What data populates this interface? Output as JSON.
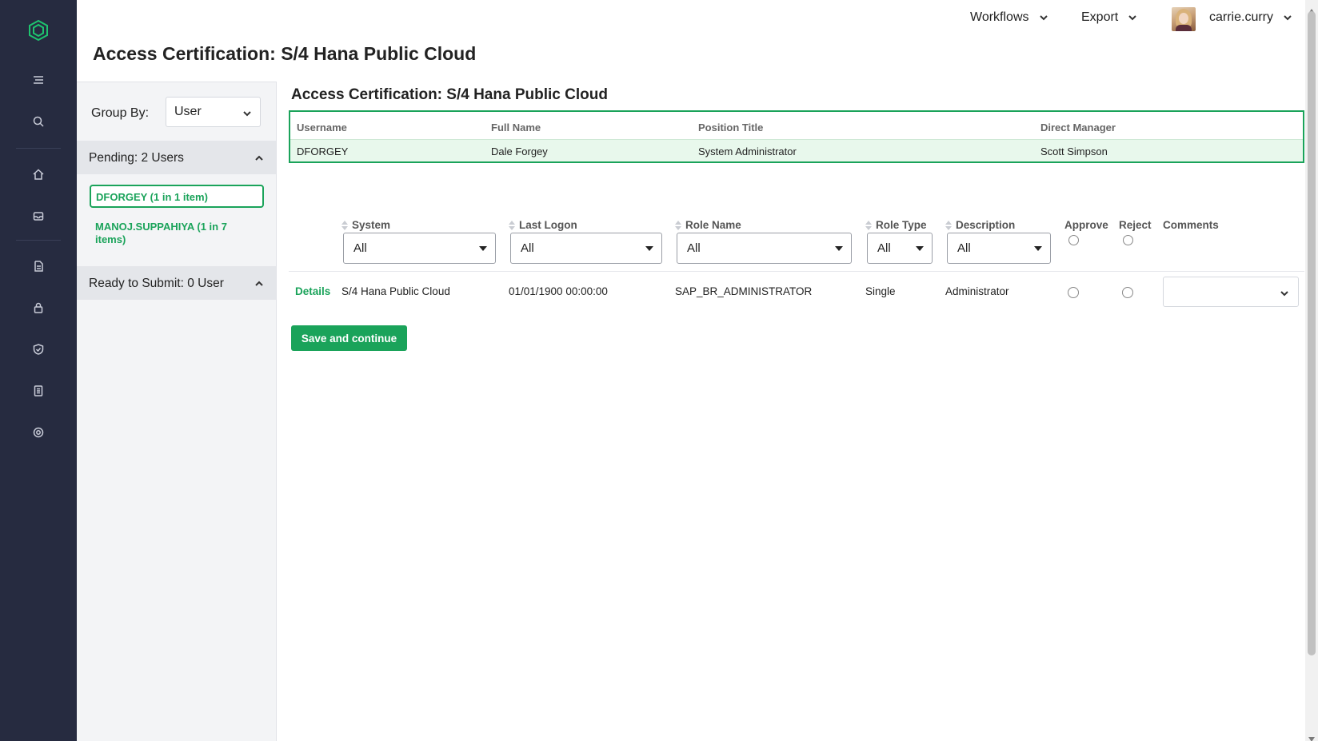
{
  "page": {
    "title": "Access Certification: S/4 Hana Public Cloud"
  },
  "topbar": {
    "workflows": "Workflows",
    "export": "Export",
    "username": "carrie.curry"
  },
  "nav": {
    "icons": [
      "menu-icon",
      "search-icon",
      "home-icon",
      "inbox-icon",
      "document-icon",
      "lock-icon",
      "shield-icon",
      "report-icon",
      "settings-icon"
    ]
  },
  "left_panel": {
    "group_by_label": "Group By:",
    "group_by_value": "User",
    "pending_header": "Pending: 2 Users",
    "users": [
      {
        "label": "DFORGEY (1 in 1 item)",
        "selected": true
      },
      {
        "label": "MANOJ.SUPPAHIYA (1 in 7 items)",
        "selected": false
      }
    ],
    "ready_header": "Ready to Submit: 0 User"
  },
  "main": {
    "heading": "Access Certification: S/4 Hana Public Cloud",
    "user_table": {
      "columns": [
        "Username",
        "Full Name",
        "Position Title",
        "Direct Manager"
      ],
      "row": [
        "DFORGEY",
        "Dale Forgey",
        "System Administrator",
        "Scott Simpson"
      ]
    },
    "role_table": {
      "columns": {
        "system": "System",
        "last_logon": "Last Logon",
        "role_name": "Role Name",
        "role_type": "Role Type",
        "description": "Description",
        "approve": "Approve",
        "reject": "Reject",
        "comments": "Comments"
      },
      "filters": {
        "system": "All",
        "last_logon": "All",
        "role_name": "All",
        "role_type": "All",
        "description": "All"
      },
      "row": {
        "details": "Details",
        "system": "S/4 Hana Public Cloud",
        "last_logon": "01/01/1900 00:00:00",
        "role_name": "SAP_BR_ADMINISTRATOR",
        "role_type": "Single",
        "description": "Administrator",
        "comments": ""
      }
    },
    "save_button": "Save and continue"
  },
  "colors": {
    "accent": "#1aa35a",
    "rail": "#262b40",
    "selected_row": "#e8f8ec"
  }
}
